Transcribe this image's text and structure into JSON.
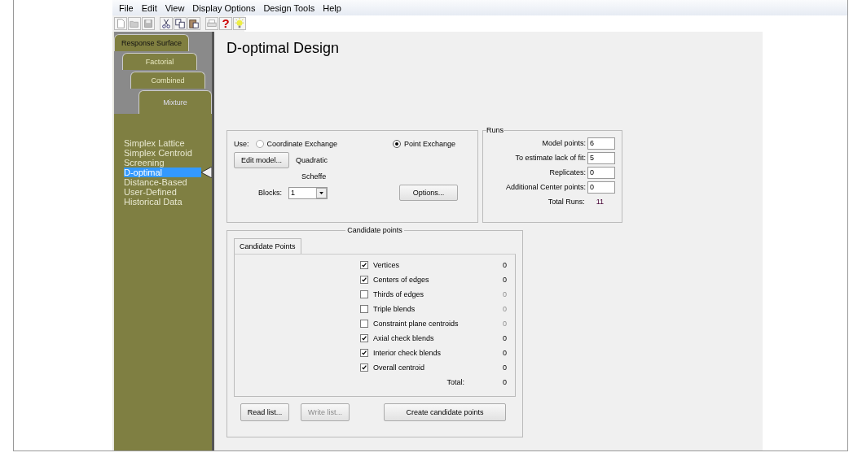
{
  "menu": [
    "File",
    "Edit",
    "View",
    "Display Options",
    "Design Tools",
    "Help"
  ],
  "toolbar": {
    "help_glyph": "?"
  },
  "design_tabs": [
    {
      "label": "Response Surface",
      "selected": false
    },
    {
      "label": "Factorial",
      "selected": false
    },
    {
      "label": "Combined",
      "selected": false
    },
    {
      "label": "Mixture",
      "selected": true
    }
  ],
  "design_types": [
    {
      "label": "Simplex Lattice",
      "selected": false
    },
    {
      "label": "Simplex Centroid",
      "selected": false
    },
    {
      "label": "Screening",
      "selected": false
    },
    {
      "label": "D-optimal",
      "selected": true
    },
    {
      "label": "Distance-Based",
      "selected": false
    },
    {
      "label": "User-Defined",
      "selected": false
    },
    {
      "label": "Historical Data",
      "selected": false
    }
  ],
  "title": "D-optimal Design",
  "options": {
    "use_label": "Use:",
    "methods": [
      {
        "label": "Coordinate Exchange",
        "selected": false
      },
      {
        "label": "Point Exchange",
        "selected": true
      }
    ],
    "edit_model_button": "Edit model...",
    "model": "Quadratic",
    "model_type": "Scheffe",
    "blocks_label": "Blocks:",
    "blocks_value": "1",
    "options_button": "Options..."
  },
  "runs": {
    "title": "Runs",
    "fields": [
      {
        "label": "Model points:",
        "value": "6"
      },
      {
        "label": "To estimate lack of fit:",
        "value": "5"
      },
      {
        "label": "Replicates:",
        "value": "0"
      },
      {
        "label": "Additional Center points:",
        "value": "0"
      }
    ],
    "total_label": "Total Runs:",
    "total_value": "11"
  },
  "candidates": {
    "title": "Candidate points",
    "tab": "Candidate Points",
    "items": [
      {
        "label": "Vertices",
        "checked": true,
        "count": "0"
      },
      {
        "label": "Centers of edges",
        "checked": true,
        "count": "0"
      },
      {
        "label": "Thirds of edges",
        "checked": false,
        "count": "0"
      },
      {
        "label": "Triple blends",
        "checked": false,
        "count": "0"
      },
      {
        "label": "Constraint plane centroids",
        "checked": false,
        "count": "0"
      },
      {
        "label": "Axial check blends",
        "checked": true,
        "count": "0"
      },
      {
        "label": "Interior check blends",
        "checked": true,
        "count": "0"
      },
      {
        "label": "Overall centroid",
        "checked": true,
        "count": "0"
      }
    ],
    "total_label": "Total:",
    "total_value": "0",
    "buttons": [
      {
        "label": "Read list...",
        "disabled": false
      },
      {
        "label": "Write list...",
        "disabled": true
      },
      {
        "label": "Create candidate points",
        "disabled": false
      }
    ]
  }
}
